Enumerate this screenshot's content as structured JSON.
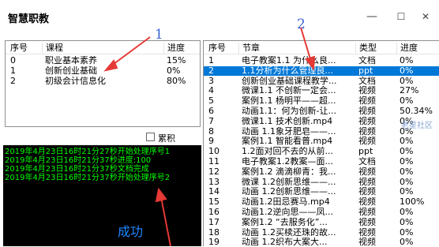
{
  "window": {
    "title": "智慧职教",
    "minimize": "—",
    "maximize": "☐",
    "close": "✕"
  },
  "courses": {
    "headers": [
      "序号",
      "课程",
      "进度"
    ],
    "rows": [
      {
        "id": "0",
        "name": "职业基本素养",
        "progress": "15%"
      },
      {
        "id": "1",
        "name": "创新创业基础",
        "progress": "0%"
      },
      {
        "id": "2",
        "name": "初级会计信息化",
        "progress": "80%"
      }
    ]
  },
  "chapters": {
    "headers": [
      "序号",
      "节章",
      "类型",
      "进度"
    ],
    "rows": [
      {
        "id": "1",
        "name": "电子教案1.1 为什么良...",
        "type": "文档",
        "progress": "0%"
      },
      {
        "id": "2",
        "name": "1.1分析为什么管理良...",
        "type": "ppt",
        "progress": "0%",
        "selected": true
      },
      {
        "id": "3",
        "name": "创新创业基础课程教学...",
        "type": "文档",
        "progress": "0%"
      },
      {
        "id": "4",
        "name": "微课1.1 不创新一定会...",
        "type": "视频",
        "progress": "27%"
      },
      {
        "id": "5",
        "name": "案例1.1 杨明平——超...",
        "type": "视频",
        "progress": "0%"
      },
      {
        "id": "6",
        "name": "动画1.1：何为创新-让...",
        "type": "视频",
        "progress": "50.34%"
      },
      {
        "id": "7",
        "name": "微课1.1 技术创新.mp4",
        "type": "视频",
        "progress": "0%"
      },
      {
        "id": "8",
        "name": "动画 1.1象牙肥皂——...",
        "type": "视频",
        "progress": "0%"
      },
      {
        "id": "9",
        "name": "案例1.1 智能看普.mp4",
        "type": "视频",
        "progress": "0%"
      },
      {
        "id": "10",
        "name": "1.2面对回不去的从前...",
        "type": "ppt",
        "progress": "0%"
      },
      {
        "id": "11",
        "name": "电子教案1.2教案—面...",
        "type": "文档",
        "progress": "0%"
      },
      {
        "id": "12",
        "name": "案例1.2 滴滴柳青：我...",
        "type": "视频",
        "progress": "0%"
      },
      {
        "id": "13",
        "name": "微课 1.2创新思维——...",
        "type": "视频",
        "progress": "0%"
      },
      {
        "id": "14",
        "name": "动画 1.2创新思维——...",
        "type": "视频",
        "progress": "0%"
      },
      {
        "id": "15",
        "name": "动画1.2田忌赛马.mp4",
        "type": "视频",
        "progress": "100%"
      },
      {
        "id": "16",
        "name": "动画1.2逆向思——凤...",
        "type": "视频",
        "progress": "0%"
      },
      {
        "id": "17",
        "name": "案例1.2 “去服务化”...",
        "type": "视频",
        "progress": "0%"
      },
      {
        "id": "18",
        "name": "动画 1.2买椟还珠的故...",
        "type": "视频",
        "progress": "0%"
      },
      {
        "id": "19",
        "name": "动画 1.2织布大案大...",
        "type": "视频",
        "progress": "0%"
      }
    ]
  },
  "console": {
    "lines": [
      "2019年4月23日16时21分27秒开始处理序号1",
      "2019年4月23日16时21分37秒进度:100",
      "2019年4月23日16时21分37秒文档完成",
      "2019年4月23日16时21分37秒开始处理序号2"
    ],
    "color": "#00ff00"
  },
  "checkbox": {
    "label": "累积",
    "checked": false
  },
  "status": {
    "success_text": "成功"
  },
  "annotations": {
    "one": "1",
    "two": "2"
  },
  "watermark": "老星社区",
  "colors": {
    "selection": "#0078d7",
    "annotation": "#3a63d6",
    "arrow": "#e53935",
    "success": "#1e88ff"
  }
}
